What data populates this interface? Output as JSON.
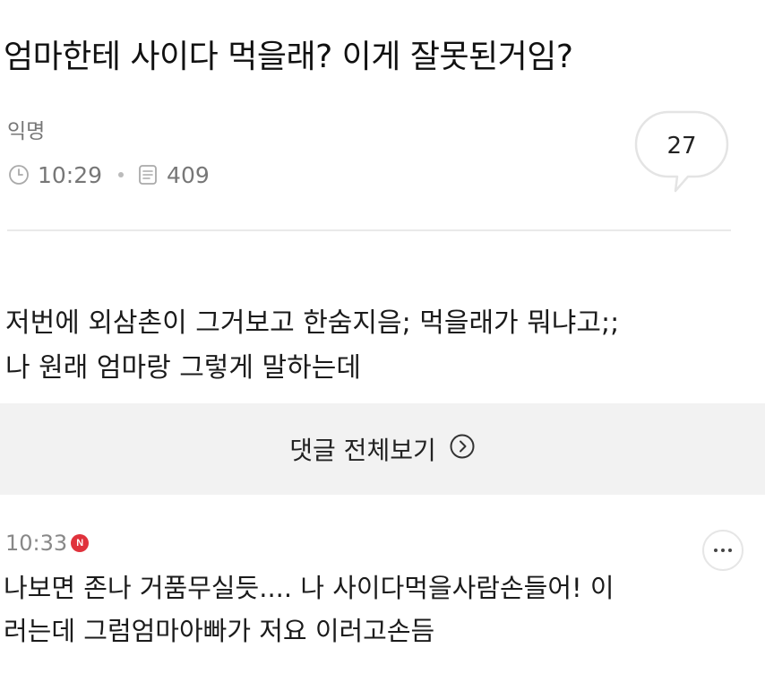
{
  "post": {
    "title": "엄마한테 사이다 먹을래? 이게 잘못된거임?",
    "author": "익명",
    "time": "10:29",
    "views": "409",
    "comment_count": "27",
    "body_lines": [
      "저번에 외삼촌이 그거보고 한숨지음; 먹을래가 뭐냐고;;",
      "나 원래 엄마랑 그렇게 말하는데"
    ]
  },
  "all_comments": {
    "label": "댓글 전체보기"
  },
  "comment": {
    "time": "10:33",
    "badge": "N",
    "lines": [
      "나보면 존나 거품무실듯.... 나 사이다먹을사람손들어! 이",
      "러는데 그럼엄마아빠가 저요 이러고손듬"
    ]
  },
  "icons": {
    "time": "clock-icon",
    "views": "document-icon",
    "comments": "speech-bubble-icon",
    "all_comments_arrow": "circle-chevron-right-icon",
    "more": "more-dots-icon"
  },
  "colors": {
    "new_badge": "#e0323c",
    "banner_bg": "#f2f2f2"
  }
}
